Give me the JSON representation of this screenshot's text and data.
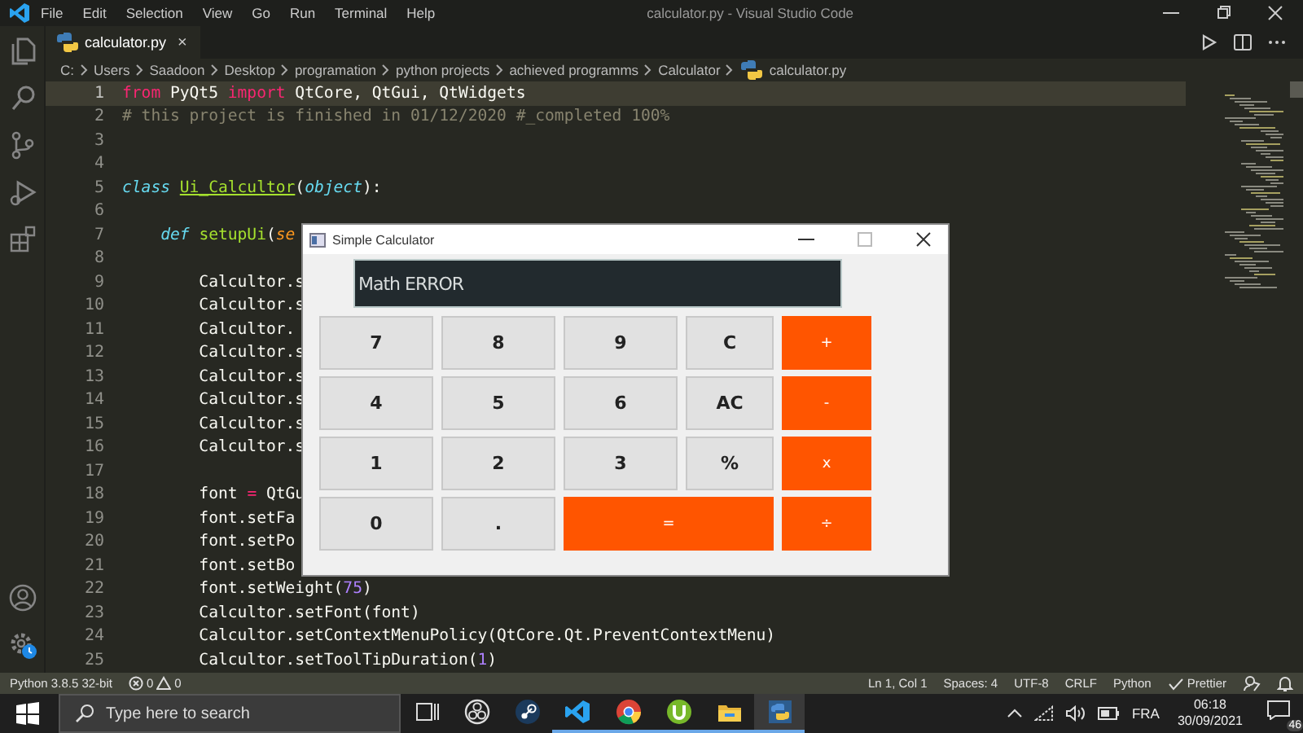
{
  "window": {
    "title": "calculator.py - Visual Studio Code"
  },
  "menu": [
    "File",
    "Edit",
    "Selection",
    "View",
    "Go",
    "Run",
    "Terminal",
    "Help"
  ],
  "tabs": [
    {
      "label": "calculator.py",
      "close": "×",
      "selected": true
    }
  ],
  "breadcrumb": [
    "C:",
    "Users",
    "Saadoon",
    "Desktop",
    "programation",
    "python projects",
    "achieved programms",
    "Calculator",
    "calculator.py"
  ],
  "editor": {
    "lines": [
      {
        "number": "1",
        "current": true,
        "tokens": [
          {
            "kind": "keyword",
            "text": "from"
          },
          {
            "kind": "plain",
            "text": " PyQt5 "
          },
          {
            "kind": "keyword",
            "text": "import"
          },
          {
            "kind": "plain",
            "text": " QtCore, QtGui, QtWidgets"
          }
        ]
      },
      {
        "number": "2",
        "current": false,
        "tokens": [
          {
            "kind": "comment",
            "text": "# this project is finished in 01/12/2020 #_completed 100%"
          }
        ]
      },
      {
        "number": "3",
        "current": false
      },
      {
        "number": "4",
        "current": false
      },
      {
        "number": "5",
        "current": false,
        "tokens": [
          {
            "kind": "storage",
            "text": "class "
          },
          {
            "kind": "class-name",
            "text": "Ui_Calcultor"
          },
          {
            "kind": "plain",
            "text": "("
          },
          {
            "kind": "storage",
            "text": "object"
          },
          {
            "kind": "plain",
            "text": "):"
          }
        ]
      },
      {
        "number": "6",
        "current": false
      },
      {
        "number": "7",
        "current": false,
        "tokens": [
          {
            "kind": "storage",
            "text": "    def "
          },
          {
            "kind": "entity",
            "text": "setupUi"
          },
          {
            "kind": "plain",
            "text": "("
          },
          {
            "kind": "param",
            "text": "se"
          }
        ]
      },
      {
        "number": "8",
        "current": false
      },
      {
        "number": "9",
        "current": false,
        "tokens": [
          {
            "kind": "plain",
            "text": "        Calcultor.s"
          }
        ]
      },
      {
        "number": "10",
        "current": false,
        "tokens": [
          {
            "kind": "plain",
            "text": "        Calcultor.s"
          }
        ]
      },
      {
        "number": "11",
        "current": false,
        "tokens": [
          {
            "kind": "plain",
            "text": "        Calcultor."
          }
        ]
      },
      {
        "number": "12",
        "current": false,
        "tokens": [
          {
            "kind": "plain",
            "text": "        Calcultor.s"
          }
        ]
      },
      {
        "number": "13",
        "current": false,
        "tokens": [
          {
            "kind": "plain",
            "text": "        Calcultor.s"
          }
        ]
      },
      {
        "number": "14",
        "current": false,
        "tokens": [
          {
            "kind": "plain",
            "text": "        Calcultor.s"
          }
        ]
      },
      {
        "number": "15",
        "current": false,
        "tokens": [
          {
            "kind": "plain",
            "text": "        Calcultor.s"
          }
        ]
      },
      {
        "number": "16",
        "current": false,
        "tokens": [
          {
            "kind": "plain",
            "text": "        Calcultor.s"
          }
        ]
      },
      {
        "number": "17",
        "current": false
      },
      {
        "number": "18",
        "current": false,
        "tokens": [
          {
            "kind": "plain",
            "text": "        font "
          },
          {
            "kind": "keyword",
            "text": "="
          },
          {
            "kind": "plain",
            "text": " QtGu"
          }
        ]
      },
      {
        "number": "19",
        "current": false,
        "tokens": [
          {
            "kind": "plain",
            "text": "        font.setFa"
          }
        ]
      },
      {
        "number": "20",
        "current": false,
        "tokens": [
          {
            "kind": "plain",
            "text": "        font.setPo"
          }
        ]
      },
      {
        "number": "21",
        "current": false,
        "tokens": [
          {
            "kind": "plain",
            "text": "        font.setBo"
          }
        ]
      },
      {
        "number": "22",
        "current": false,
        "tokens": [
          {
            "kind": "plain",
            "text": "        font.setWeight("
          },
          {
            "kind": "number",
            "text": "75"
          },
          {
            "kind": "plain",
            "text": ")"
          }
        ]
      },
      {
        "number": "23",
        "current": false,
        "tokens": [
          {
            "kind": "plain",
            "text": "        Calcultor.setFont(font)"
          }
        ]
      },
      {
        "number": "24",
        "current": false,
        "tokens": [
          {
            "kind": "plain",
            "text": "        Calcultor.setContextMenuPolicy(QtCore.Qt.PreventContextMenu)"
          }
        ]
      },
      {
        "number": "25",
        "current": false,
        "tokens": [
          {
            "kind": "plain",
            "text": "        Calcultor.setToolTipDuration("
          },
          {
            "kind": "number",
            "text": "1"
          },
          {
            "kind": "plain",
            "text": ")"
          }
        ]
      }
    ]
  },
  "calculator": {
    "title": "Simple Calculator",
    "display": "Math ERROR",
    "buttons": [
      {
        "label": "7",
        "kind": "digit"
      },
      {
        "label": "8",
        "kind": "digit"
      },
      {
        "label": "9",
        "kind": "digit"
      },
      {
        "label": "C",
        "kind": "digit"
      },
      {
        "label": "+",
        "kind": "operator"
      },
      {
        "label": "4",
        "kind": "digit"
      },
      {
        "label": "5",
        "kind": "digit"
      },
      {
        "label": "6",
        "kind": "digit"
      },
      {
        "label": "AC",
        "kind": "digit"
      },
      {
        "label": "-",
        "kind": "operator"
      },
      {
        "label": "1",
        "kind": "digit"
      },
      {
        "label": "2",
        "kind": "digit"
      },
      {
        "label": "3",
        "kind": "digit"
      },
      {
        "label": "%",
        "kind": "digit"
      },
      {
        "label": "x",
        "kind": "operator"
      },
      {
        "label": "0",
        "kind": "digit"
      },
      {
        "label": ".",
        "kind": "digit"
      },
      {
        "label": "=",
        "kind": "equals"
      },
      {
        "label": "÷",
        "kind": "operator"
      }
    ]
  },
  "status_bar": {
    "interpreter": "Python 3.8.5 32-bit",
    "errors": "0",
    "warnings": "0",
    "items": [
      "Ln 1, Col 1",
      "Spaces: 4",
      "UTF-8",
      "CRLF",
      "Python"
    ],
    "prettier": "Prettier"
  },
  "taskbar": {
    "search": {
      "placeholder": "Type here to search"
    },
    "apps": [
      {
        "kind": "task-view",
        "running": false,
        "selected": false
      },
      {
        "kind": "obs",
        "running": false,
        "selected": false
      },
      {
        "kind": "steam",
        "running": false,
        "selected": false
      },
      {
        "kind": "vscode",
        "running": true,
        "selected": false
      },
      {
        "kind": "chrome",
        "running": true,
        "selected": false
      },
      {
        "kind": "utorrent",
        "running": true,
        "selected": false
      },
      {
        "kind": "files",
        "running": true,
        "selected": false
      },
      {
        "kind": "python",
        "running": true,
        "selected": true
      }
    ],
    "language": "FRA",
    "time": "06:18",
    "date": "30/09/2021",
    "notifications": "46"
  }
}
